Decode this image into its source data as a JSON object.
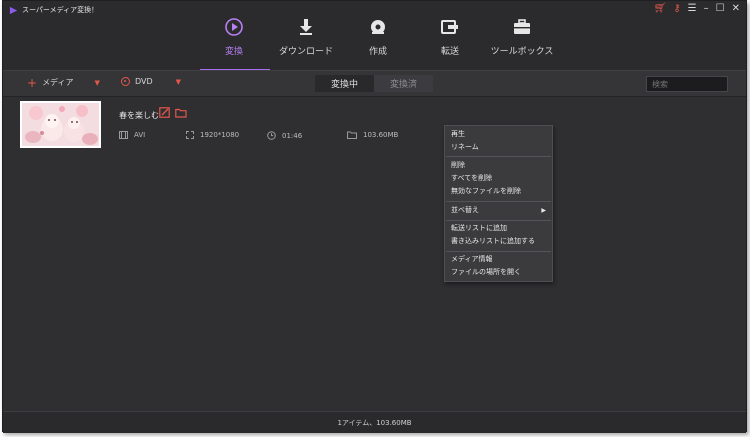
{
  "app": {
    "title": "スーパーメディア変換！"
  },
  "window_controls": [
    "cart-icon",
    "key-icon",
    "menu-icon",
    "minimize-icon",
    "maximize-icon",
    "close-icon"
  ],
  "nav": {
    "tabs": [
      {
        "label": "変換",
        "icon": "convert-icon",
        "active": true
      },
      {
        "label": "ダウンロード",
        "icon": "download-icon",
        "active": false
      },
      {
        "label": "作成",
        "icon": "burn-icon",
        "active": false
      },
      {
        "label": "転送",
        "icon": "transfer-icon",
        "active": false
      },
      {
        "label": "ツールボックス",
        "icon": "toolbox-icon",
        "active": false
      }
    ]
  },
  "toolbar": {
    "add_media": "メディア",
    "dvd": "DVD",
    "converting": "変換中",
    "converted": "変換済",
    "search_placeholder": "検索"
  },
  "file": {
    "name": "春を楽しむ",
    "format": "AVI",
    "resolution": "1920*1080",
    "duration": "01:46",
    "size": "103.60MB"
  },
  "context_menu": {
    "items": [
      {
        "label": "再生"
      },
      {
        "label": "リネーム"
      },
      {
        "label": "削除"
      },
      {
        "label": "すべてを削除"
      },
      {
        "label": "無効なファイルを削除"
      },
      {
        "label": "並べ替え",
        "submenu": true
      },
      {
        "label": "転送リストに追加"
      },
      {
        "label": "書き込みリストに追加する"
      },
      {
        "label": "メディア情報"
      },
      {
        "label": "ファイルの場所を開く"
      }
    ]
  },
  "status": {
    "text": "1アイテム、103.60MB"
  },
  "colors": {
    "accent": "#a66cf0",
    "highlight": "#e2574c",
    "background": "#2e2d30"
  }
}
